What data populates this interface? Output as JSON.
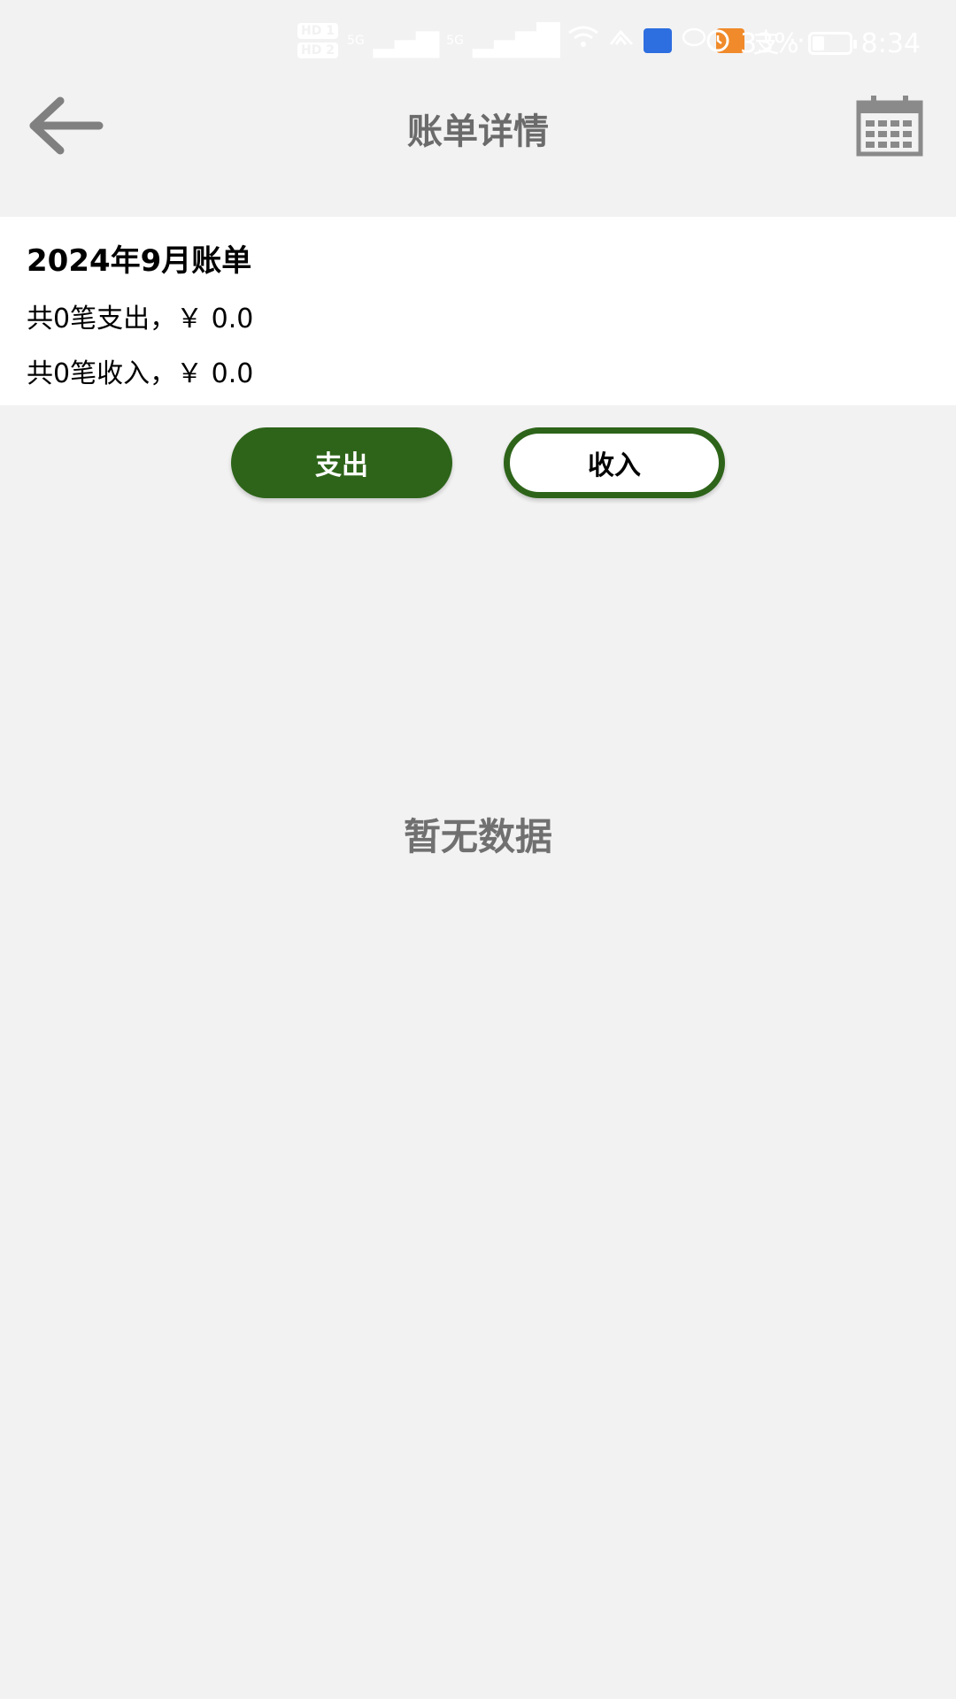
{
  "status_bar": {
    "hd1": "HD 1",
    "hd2": "HD 2",
    "sim1_label": "5G",
    "sim2_label": "5G",
    "pay_glyph": "支",
    "more": "···",
    "battery": "33%",
    "battery_level": 0.33,
    "time": "8:34"
  },
  "header": {
    "title": "账单详情",
    "back_icon": "arrow-left-icon",
    "calendar_icon": "calendar-icon"
  },
  "summary": {
    "title": "2024年9月账单",
    "expense_line": "共0笔支出，￥ 0.0",
    "income_line": "共0笔收入，￥ 0.0"
  },
  "tabs": {
    "expense_label": "支出",
    "income_label": "收入",
    "selected": "expense"
  },
  "empty_state": {
    "text": "暂无数据"
  },
  "colors": {
    "accent": "#2d6419",
    "background": "#f2f2f2",
    "card": "#ffffff",
    "title_gray": "#6b6b6b"
  }
}
